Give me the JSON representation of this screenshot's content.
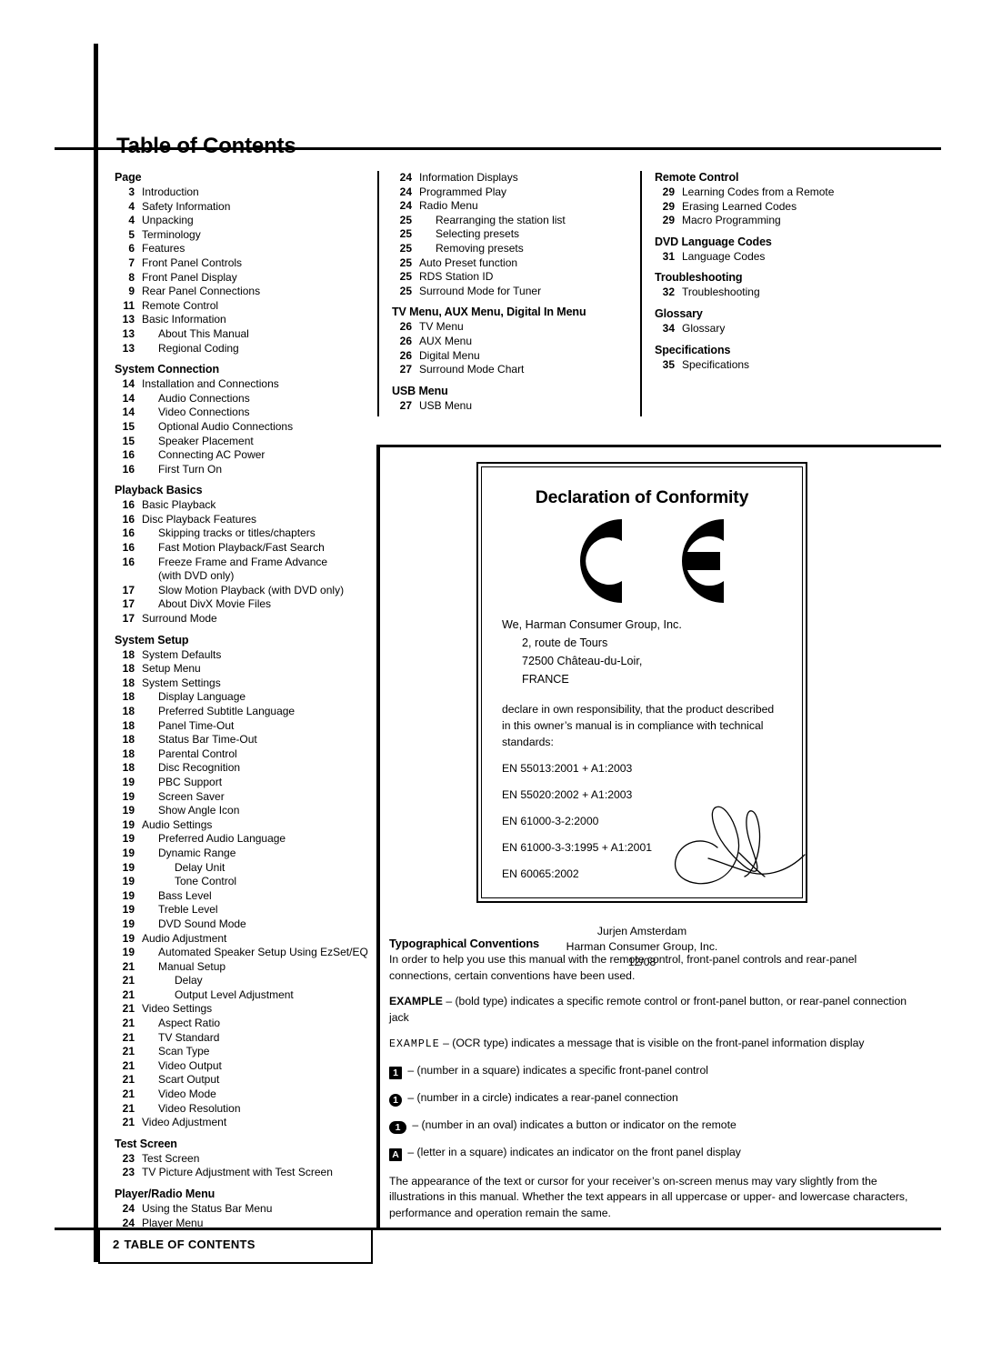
{
  "document": {
    "title": "Table of Contents",
    "footer": {
      "page_number": "2",
      "label": "TABLE OF CONTENTS"
    }
  },
  "toc": {
    "column1": [
      {
        "type": "head",
        "text": "Page"
      },
      {
        "page": "3",
        "text": "Introduction",
        "indent": 0
      },
      {
        "page": "4",
        "text": "Safety Information",
        "indent": 0
      },
      {
        "page": "4",
        "text": "Unpacking",
        "indent": 0
      },
      {
        "page": "5",
        "text": "Terminology",
        "indent": 0
      },
      {
        "page": "6",
        "text": "Features",
        "indent": 0
      },
      {
        "page": "7",
        "text": "Front Panel Controls",
        "indent": 0
      },
      {
        "page": "8",
        "text": "Front Panel Display",
        "indent": 0
      },
      {
        "page": "9",
        "text": "Rear Panel Connections",
        "indent": 0
      },
      {
        "page": "11",
        "text": "Remote Control",
        "indent": 0
      },
      {
        "page": "13",
        "text": "Basic Information",
        "indent": 0
      },
      {
        "page": "13",
        "text": "About This Manual",
        "indent": 1
      },
      {
        "page": "13",
        "text": "Regional Coding",
        "indent": 1
      },
      {
        "type": "head",
        "text": "System Connection"
      },
      {
        "page": "14",
        "text": "Installation and Connections",
        "indent": 0
      },
      {
        "page": "14",
        "text": "Audio Connections",
        "indent": 1
      },
      {
        "page": "14",
        "text": "Video Connections",
        "indent": 1
      },
      {
        "page": "15",
        "text": "Optional Audio Connections",
        "indent": 1
      },
      {
        "page": "15",
        "text": "Speaker Placement",
        "indent": 1
      },
      {
        "page": "16",
        "text": "Connecting AC Power",
        "indent": 1
      },
      {
        "page": "16",
        "text": "First Turn On",
        "indent": 1
      },
      {
        "type": "head",
        "text": "Playback Basics"
      },
      {
        "page": "16",
        "text": "Basic Playback",
        "indent": 0
      },
      {
        "page": "16",
        "text": "Disc Playback Features",
        "indent": 0
      },
      {
        "page": "16",
        "text": "Skipping tracks or titles/chapters",
        "indent": 1
      },
      {
        "page": "16",
        "text": "Fast Motion Playback/Fast Search",
        "indent": 1
      },
      {
        "page": "16",
        "text": "Freeze Frame and Frame Advance",
        "indent": 1
      },
      {
        "page": "",
        "text": "(with DVD only)",
        "indent": 1
      },
      {
        "page": "17",
        "text": "Slow Motion Playback (with DVD only)",
        "indent": 1
      },
      {
        "page": "17",
        "text": "About DivX Movie Files",
        "indent": 1
      },
      {
        "page": "17",
        "text": "Surround Mode",
        "indent": 0
      },
      {
        "type": "head",
        "text": "System Setup"
      },
      {
        "page": "18",
        "text": "System Defaults",
        "indent": 0
      },
      {
        "page": "18",
        "text": "Setup Menu",
        "indent": 0
      },
      {
        "page": "18",
        "text": "System Settings",
        "indent": 0
      },
      {
        "page": "18",
        "text": "Display Language",
        "indent": 1
      },
      {
        "page": "18",
        "text": "Preferred Subtitle Language",
        "indent": 1
      },
      {
        "page": "18",
        "text": "Panel Time-Out",
        "indent": 1
      },
      {
        "page": "18",
        "text": "Status Bar Time-Out",
        "indent": 1
      },
      {
        "page": "18",
        "text": "Parental Control",
        "indent": 1
      },
      {
        "page": "18",
        "text": "Disc Recognition",
        "indent": 1
      },
      {
        "page": "19",
        "text": "PBC Support",
        "indent": 1
      },
      {
        "page": "19",
        "text": "Screen Saver",
        "indent": 1
      },
      {
        "page": "19",
        "text": "Show Angle Icon",
        "indent": 1
      },
      {
        "page": "19",
        "text": "Audio Settings",
        "indent": 0
      },
      {
        "page": "19",
        "text": "Preferred Audio Language",
        "indent": 1
      },
      {
        "page": "19",
        "text": "Dynamic Range",
        "indent": 1
      },
      {
        "page": "19",
        "text": "Delay Unit",
        "indent": 2
      },
      {
        "page": "19",
        "text": "Tone Control",
        "indent": 2
      },
      {
        "page": "19",
        "text": "Bass Level",
        "indent": 1
      },
      {
        "page": "19",
        "text": "Treble Level",
        "indent": 1
      },
      {
        "page": "19",
        "text": "DVD Sound Mode",
        "indent": 1
      },
      {
        "page": "19",
        "text": "Audio Adjustment",
        "indent": 0
      },
      {
        "page": "19",
        "text": "Automated Speaker Setup Using EzSet/EQ",
        "indent": 1
      },
      {
        "page": "21",
        "text": "Manual Setup",
        "indent": 1
      },
      {
        "page": "21",
        "text": "Delay",
        "indent": 2
      },
      {
        "page": "21",
        "text": "Output Level Adjustment",
        "indent": 2
      },
      {
        "page": "21",
        "text": "Video Settings",
        "indent": 0
      },
      {
        "page": "21",
        "text": "Aspect Ratio",
        "indent": 1
      },
      {
        "page": "21",
        "text": "TV Standard",
        "indent": 1
      },
      {
        "page": "21",
        "text": "Scan Type",
        "indent": 1
      },
      {
        "page": "21",
        "text": "Video Output",
        "indent": 1
      },
      {
        "page": "21",
        "text": "Scart Output",
        "indent": 1
      },
      {
        "page": "21",
        "text": "Video Mode",
        "indent": 1
      },
      {
        "page": "21",
        "text": "Video Resolution",
        "indent": 1
      },
      {
        "page": "21",
        "text": "Video Adjustment",
        "indent": 0
      },
      {
        "type": "head",
        "text": "Test Screen"
      },
      {
        "page": "23",
        "text": "Test Screen",
        "indent": 0
      },
      {
        "page": "23",
        "text": "TV Picture Adjustment with Test Screen",
        "indent": 0
      },
      {
        "type": "head",
        "text": "Player/Radio Menu"
      },
      {
        "page": "24",
        "text": "Using the Status Bar Menu",
        "indent": 0
      },
      {
        "page": "24",
        "text": "Player Menu",
        "indent": 0
      }
    ],
    "column2": [
      {
        "page": "24",
        "text": "Information Displays",
        "indent": 0
      },
      {
        "page": "24",
        "text": "Programmed Play",
        "indent": 0
      },
      {
        "page": "24",
        "text": "Radio Menu",
        "indent": 0
      },
      {
        "page": "25",
        "text": "Rearranging the station list",
        "indent": 1
      },
      {
        "page": "25",
        "text": "Selecting presets",
        "indent": 1
      },
      {
        "page": "25",
        "text": "Removing presets",
        "indent": 1
      },
      {
        "page": "25",
        "text": "Auto Preset function",
        "indent": 0
      },
      {
        "page": "25",
        "text": "RDS Station ID",
        "indent": 0
      },
      {
        "page": "25",
        "text": "Surround Mode for Tuner",
        "indent": 0
      },
      {
        "type": "head",
        "text": "TV Menu, AUX Menu, Digital In Menu"
      },
      {
        "page": "26",
        "text": "TV Menu",
        "indent": 0
      },
      {
        "page": "26",
        "text": "AUX Menu",
        "indent": 0
      },
      {
        "page": "26",
        "text": "Digital Menu",
        "indent": 0
      },
      {
        "page": "27",
        "text": "Surround Mode Chart",
        "indent": 0
      },
      {
        "type": "head",
        "text": "USB Menu"
      },
      {
        "page": "27",
        "text": "USB Menu",
        "indent": 0
      }
    ],
    "column3": [
      {
        "type": "head",
        "text": "Remote Control"
      },
      {
        "page": "29",
        "text": "Learning Codes from a Remote",
        "indent": 0
      },
      {
        "page": "29",
        "text": "Erasing Learned Codes",
        "indent": 0
      },
      {
        "page": "29",
        "text": "Macro Programming",
        "indent": 0
      },
      {
        "type": "head",
        "text": "DVD Language Codes"
      },
      {
        "page": "31",
        "text": "Language  Codes",
        "indent": 0
      },
      {
        "type": "head",
        "text": "Troubleshooting"
      },
      {
        "page": "32",
        "text": "Troubleshooting",
        "indent": 0
      },
      {
        "type": "head",
        "text": "Glossary"
      },
      {
        "page": "34",
        "text": "Glossary",
        "indent": 0
      },
      {
        "type": "head",
        "text": "Specifications"
      },
      {
        "page": "35",
        "text": "Specifications",
        "indent": 0
      }
    ]
  },
  "declaration": {
    "title": "Declaration of Conformity",
    "ce_mark": "CE",
    "address": {
      "line1": "We, Harman Consumer Group, Inc.",
      "line2": "2, route de Tours",
      "line3": "72500 Château-du-Loir,",
      "line4": "FRANCE"
    },
    "body": "declare in own responsibility, that the product described in this owner’s manual is in compliance with technical standards:",
    "standards": [
      "EN 55013:2001 + A1:2003",
      "EN 55020:2002 + A1:2003",
      "EN 61000-3-2:2000",
      "EN 61000-3-3:1995 + A1:2001",
      "EN 60065:2002"
    ],
    "signatory": {
      "name": "Jurjen Amsterdam",
      "company": "Harman Consumer Group, Inc.",
      "date": "12/08"
    }
  },
  "typographical": {
    "heading": "Typographical Conventions",
    "intro": "In order to help you use this manual with the remote control, front-panel controls and rear-panel connections, certain conventions have been used.",
    "bold_example": {
      "term": "EXAMPLE",
      "description": "– (bold type) indicates a specific remote control or front-panel button, or rear-panel connection jack"
    },
    "ocr_example": {
      "term": "EXAMPLE",
      "description": "– (OCR type) indicates a message that is visible on the front-panel information display"
    },
    "markers": [
      {
        "glyph": "1",
        "shape": "square",
        "description": "– (number in a square) indicates a specific front-panel control"
      },
      {
        "glyph": "1",
        "shape": "circle",
        "description": "– (number in a circle) indicates a rear-panel connection"
      },
      {
        "glyph": "1",
        "shape": "oval",
        "description": "– (number in an oval) indicates a button or indicator on the remote"
      },
      {
        "glyph": "A",
        "shape": "square",
        "description": "– (letter in a square) indicates an indicator on the front panel display"
      }
    ],
    "closing": "The appearance of the text or cursor for your receiver’s on-screen menus may vary slightly from the illustrations in this manual. Whether the text appears in all uppercase or upper- and lowercase characters, performance and operation remain the same."
  }
}
